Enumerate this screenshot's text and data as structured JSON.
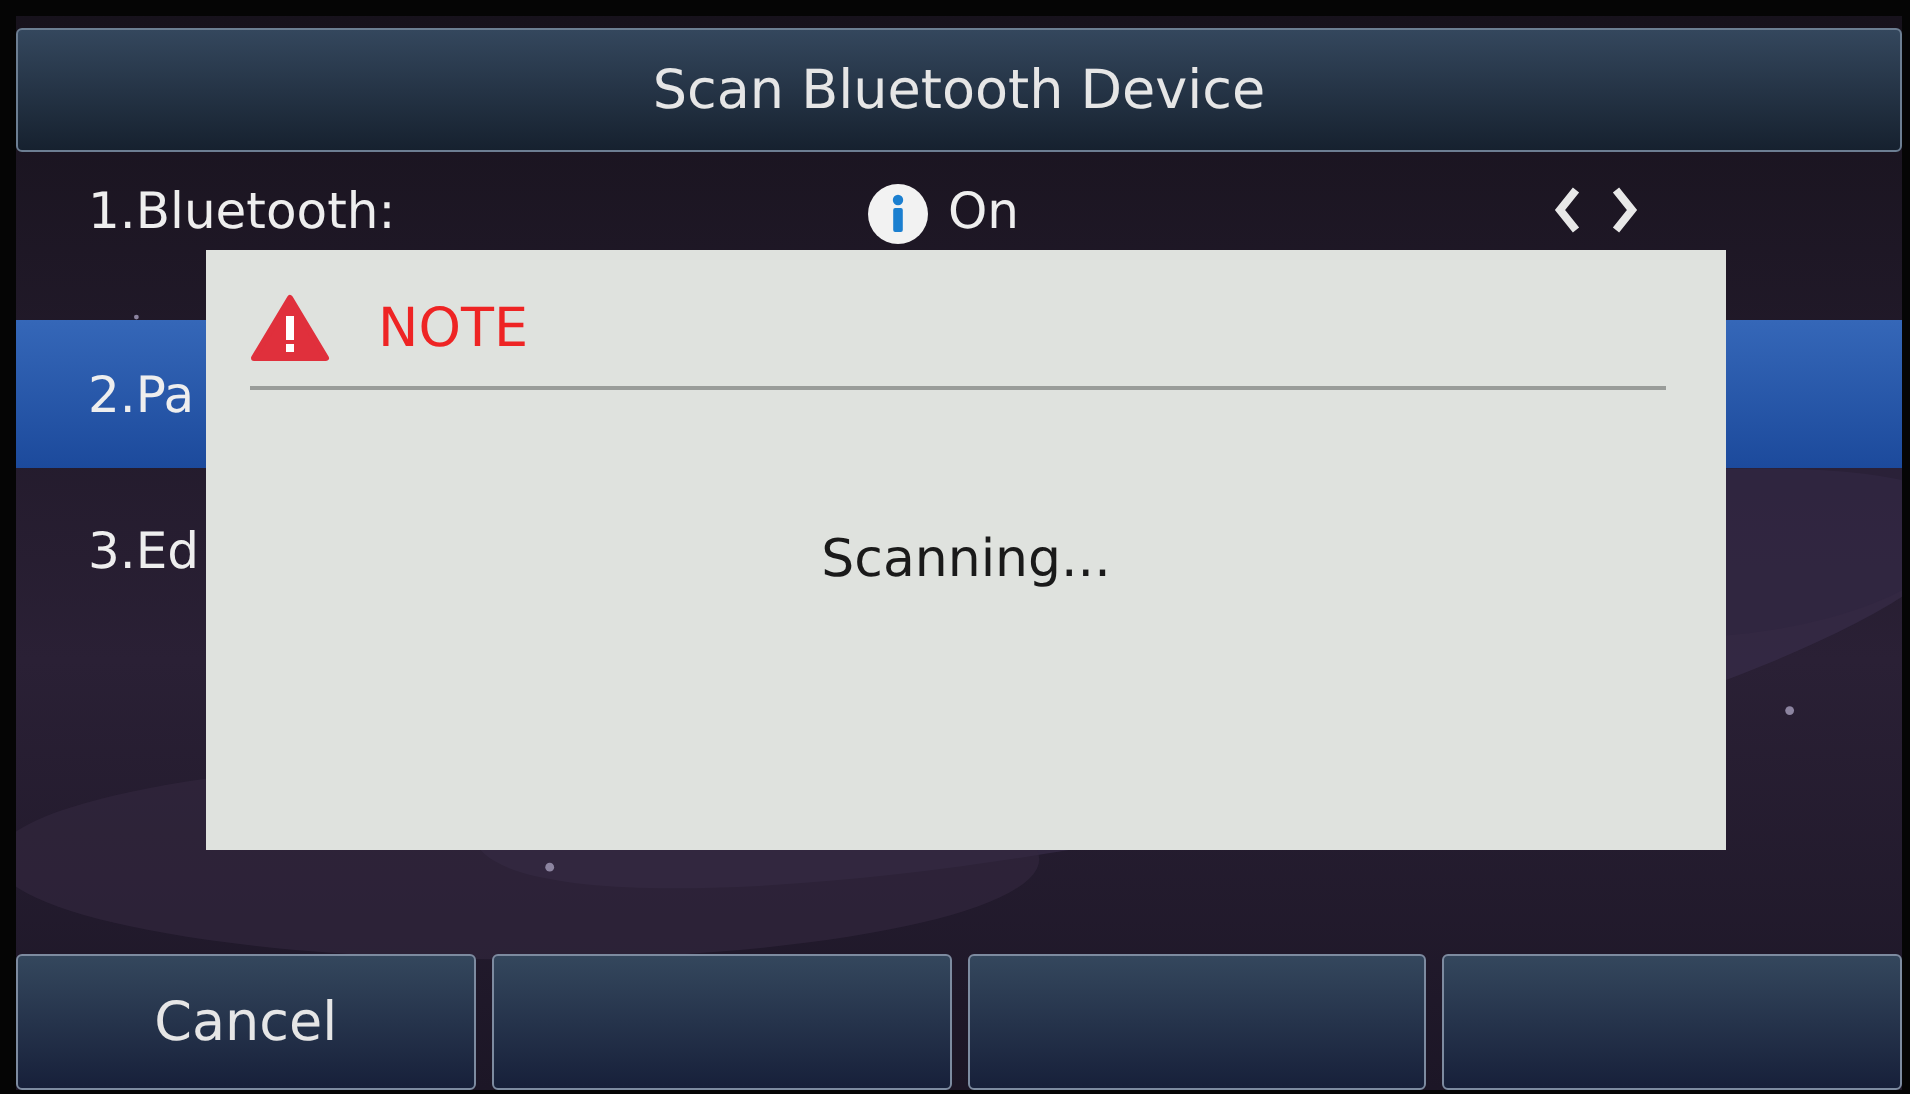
{
  "title": "Scan Bluetooth Device",
  "menu": [
    {
      "kind": "toggle",
      "label": "1.Bluetooth:",
      "value": "On",
      "selected": false
    },
    {
      "kind": "plain",
      "label": "2.Pa",
      "selected": true
    },
    {
      "kind": "plain",
      "label": "3.Ed",
      "selected": false
    }
  ],
  "dialog": {
    "title": "NOTE",
    "message": "Scanning..."
  },
  "softkeys": [
    {
      "kind": "labeled",
      "label": "Cancel"
    },
    {
      "kind": "blank"
    },
    {
      "kind": "blank"
    },
    {
      "kind": "blank"
    }
  ]
}
